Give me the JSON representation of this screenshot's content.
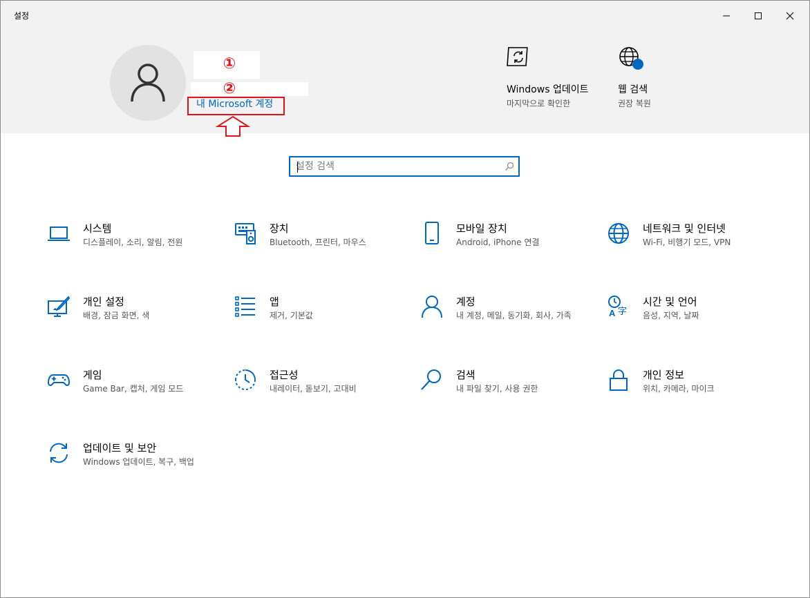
{
  "window": {
    "title": "설정",
    "minimize_label": "최소화",
    "maximize_label": "최대화",
    "close_label": "닫기"
  },
  "account": {
    "markers": [
      "①",
      "②"
    ],
    "ms_account_link": "내 Microsoft 계정"
  },
  "quick_links": [
    {
      "title": "Windows 업데이트",
      "subtitle": "마지막으로 확인한",
      "icon": "windows-update-icon"
    },
    {
      "title": "웹 검색",
      "subtitle": "권장 복원",
      "icon": "web-search-icon"
    }
  ],
  "search": {
    "placeholder": "설정 검색",
    "value": "",
    "icon": "search-icon"
  },
  "categories": [
    {
      "title": "시스템",
      "subtitle": "디스플레이, 소리, 알림, 전원",
      "icon": "laptop-icon"
    },
    {
      "title": "장치",
      "subtitle": "Bluetooth, 프린터, 마우스",
      "icon": "devices-icon"
    },
    {
      "title": "모바일 장치",
      "subtitle": "Android, iPhone 연결",
      "icon": "phone-icon"
    },
    {
      "title": "네트워크 및 인터넷",
      "subtitle": "Wi-Fi, 비행기 모드, VPN",
      "icon": "globe-icon"
    },
    {
      "title": "개인 설정",
      "subtitle": "배경, 잠금 화면, 색",
      "icon": "personalization-icon"
    },
    {
      "title": "앱",
      "subtitle": "제거, 기본값",
      "icon": "apps-list-icon"
    },
    {
      "title": "계정",
      "subtitle": "내 계정, 메일, 동기화, 회사, 가족",
      "icon": "person-icon"
    },
    {
      "title": "시간 및 언어",
      "subtitle": "음성, 지역, 날짜",
      "icon": "time-language-icon"
    },
    {
      "title": "게임",
      "subtitle": "Game Bar, 캡처, 게임 모드",
      "icon": "gamepad-icon"
    },
    {
      "title": "접근성",
      "subtitle": "내레이터, 돋보기, 고대비",
      "icon": "accessibility-icon"
    },
    {
      "title": "검색",
      "subtitle": "내 파일 찾기, 사용 권한",
      "icon": "search-icon"
    },
    {
      "title": "개인 정보",
      "subtitle": "위치, 카메라, 마이크",
      "icon": "lock-icon"
    },
    {
      "title": "업데이트 및 보안",
      "subtitle": "Windows 업데이트, 복구, 백업",
      "icon": "sync-icon"
    }
  ],
  "colors": {
    "accent": "#0067c0",
    "annotation_red": "#e0131a",
    "header_bg": "#f2f2f2"
  }
}
